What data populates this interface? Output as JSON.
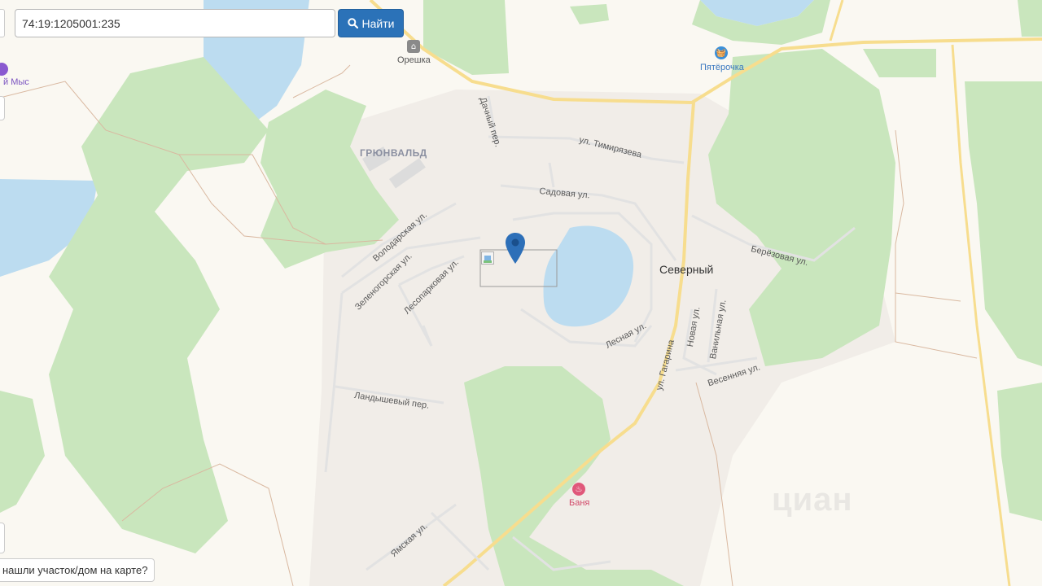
{
  "search": {
    "value": "74:19:1205001:235",
    "button_label": "Найти",
    "button_icon": "search-icon"
  },
  "map": {
    "district": "ГРЮНВАЛЬД",
    "town": "Северный",
    "pois": [
      {
        "name": "Орешка",
        "icon": "shop-icon",
        "color": "#8a8a8a"
      },
      {
        "name": "Пятёрочка",
        "icon": "basket-icon",
        "color": "#3a8fd8"
      },
      {
        "name": "Баня",
        "icon": "bath-icon",
        "color": "#e0587a"
      },
      {
        "name": "й Мыс",
        "icon": "place-icon",
        "color": "#8a5ad0"
      }
    ],
    "streets": {
      "dachny": "Дачный пер.",
      "timiryazeva": "ул. Тимирязева",
      "sadovaya": "Садовая ул.",
      "volodarskaya": "Володарская ул.",
      "zelenogorskaya": "Зеленогорская ул.",
      "lesoparkovaya": "Лесопарковая ул.",
      "berezovaya": "Берёзовая ул.",
      "lesnaya": "Лесная ул.",
      "novaya": "Новая ул.",
      "vanilnaya": "Ванильная ул.",
      "vesennyaya": "Весенняя ул.",
      "gagarina": "ул. Гагарина",
      "landyshevy": "Ландышевый пер.",
      "yamskaya": "Ямская ул."
    },
    "marker_icon": "map-pin-icon",
    "broken_image_icon": "broken-image-icon",
    "watermark": "циан"
  },
  "help": {
    "label": "нашли участок/дом на карте?"
  },
  "colors": {
    "forest": "#c9e6bd",
    "water": "#bcdcf0",
    "road_major": "#f7dd8e",
    "road_minor": "#e2e2e2",
    "background": "#faf8f2",
    "settlement": "#f1ede8",
    "marker": "#2d6fb8",
    "button": "#2b72b8"
  }
}
